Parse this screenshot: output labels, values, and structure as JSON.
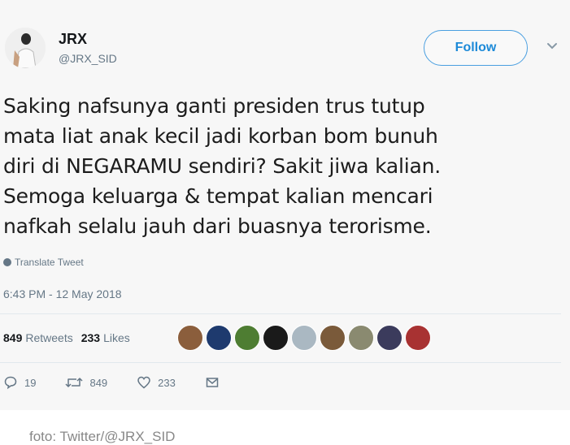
{
  "user": {
    "name": "JRX",
    "handle": "@JRX_SID",
    "follow_label": "Follow"
  },
  "tweet": {
    "lines": [
      "Saking nafsunya ganti presiden trus tutup",
      "mata liat anak kecil jadi korban bom bunuh",
      "diri di NEGARAMU sendiri? Sakit jiwa kalian.",
      "Semoga keluarga & tempat kalian mencari",
      "nafkah selalu jauh dari buasnya terorisme."
    ],
    "translate_label": "Translate Tweet",
    "timestamp": "6:43 PM - 12 May 2018"
  },
  "stats": {
    "retweets_count": "849",
    "retweets_label": "Retweets",
    "likes_count": "233",
    "likes_label": "Likes"
  },
  "likers": [
    {
      "icon": "user-avatar-1",
      "color": "#8b5e3c"
    },
    {
      "icon": "user-avatar-2",
      "color": "#1e3a6e"
    },
    {
      "icon": "user-avatar-3",
      "color": "#4e7d32"
    },
    {
      "icon": "user-avatar-4",
      "color": "#1a1a1a"
    },
    {
      "icon": "user-avatar-5",
      "color": "#aab8c2"
    },
    {
      "icon": "user-avatar-6",
      "color": "#7a5a3a"
    },
    {
      "icon": "user-avatar-7",
      "color": "#8a8a70"
    },
    {
      "icon": "user-avatar-8",
      "color": "#3b3b5c"
    },
    {
      "icon": "user-avatar-9",
      "color": "#a83232"
    }
  ],
  "actions": {
    "reply_count": "19",
    "retweet_count": "849",
    "like_count": "233"
  },
  "caption": "foto: Twitter/@JRX_SID",
  "colors": {
    "accent": "#1d8ad8",
    "muted": "#657786",
    "card_bg": "#f7f7f7"
  }
}
